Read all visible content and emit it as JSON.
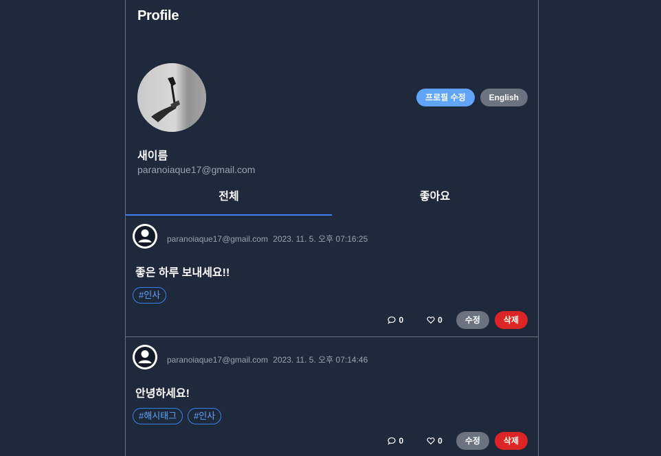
{
  "profile": {
    "title": "Profile",
    "edit_label": "프로필 수정",
    "language_label": "English",
    "name": "새이름",
    "email": "paranoiaque17@gmail.com"
  },
  "tabs": [
    {
      "label": "전체",
      "active": true
    },
    {
      "label": "좋아요",
      "active": false
    }
  ],
  "posts": [
    {
      "email": "paranoiaque17@gmail.com",
      "date": "2023. 11. 5. 오후 07:16:25",
      "content": "좋은 하루 보내세요!!",
      "tags": [
        "#인사"
      ],
      "comments": "0",
      "likes": "0",
      "edit_label": "수정",
      "delete_label": "삭제"
    },
    {
      "email": "paranoiaque17@gmail.com",
      "date": "2023. 11. 5. 오후 07:14:46",
      "content": "안녕하세요!",
      "tags": [
        "#해시태그",
        "#인사"
      ],
      "comments": "0",
      "likes": "0",
      "edit_label": "수정",
      "delete_label": "삭제"
    }
  ],
  "colors": {
    "background": "#1e293b",
    "accent": "#3b82f6",
    "edit_profile": "#60a5fa",
    "secondary": "#6b7280",
    "danger": "#dc2626"
  },
  "icons": {
    "avatar": "user-avatar-icon",
    "comment": "comment-icon",
    "like": "heart-icon"
  }
}
